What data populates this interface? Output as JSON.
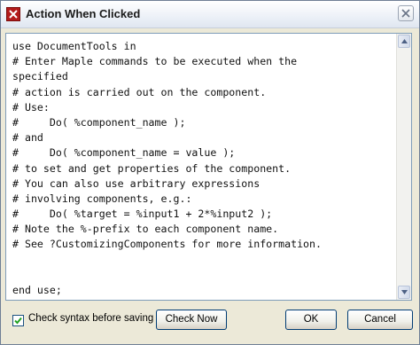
{
  "window": {
    "title": "Action When Clicked"
  },
  "icons": {
    "app": "maple-app-icon",
    "close": "close-icon",
    "scroll_up": "arrow-up-icon",
    "scroll_down": "arrow-down-icon",
    "check": "checkmark-icon"
  },
  "editor": {
    "lines": [
      "use DocumentTools in",
      "# Enter Maple commands to be executed when the",
      "specified",
      "# action is carried out on the component.",
      "# Use:",
      "#     Do( %component_name );",
      "# and",
      "#     Do( %component_name = value );",
      "# to set and get properties of the component.",
      "# You can also use arbitrary expressions",
      "# involving components, e.g.:",
      "#     Do( %target = %input1 + 2*%input2 );",
      "# Note the %-prefix to each component name.",
      "# See ?CustomizingComponents for more information.",
      "",
      "",
      "end use;"
    ]
  },
  "footer": {
    "check_syntax_label": "Check syntax before saving",
    "check_syntax_checked": true,
    "check_now_label": "Check Now",
    "ok_label": "OK",
    "cancel_label": "Cancel"
  },
  "colors": {
    "accent": "#b31b1b",
    "button_border": "#003c74",
    "dialog_bg": "#ece9d8"
  }
}
